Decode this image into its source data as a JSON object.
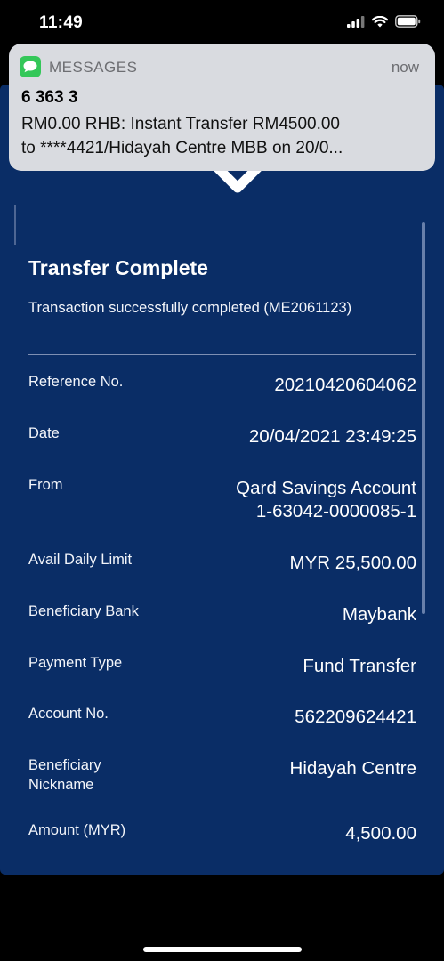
{
  "status": {
    "time": "11:49"
  },
  "notification": {
    "app": "MESSAGES",
    "time": "now",
    "sender": "6 363 3",
    "line1": "RM0.00 RHB: Instant Transfer RM4500.00",
    "line2": "to ****4421/Hidayah Centre MBB on 20/0..."
  },
  "receipt": {
    "title": "Transfer Complete",
    "subtitle": "Transaction successfully completed (ME2061123)",
    "rows": [
      {
        "label": "Reference No.",
        "value": "20210420604062"
      },
      {
        "label": "Date",
        "value": "20/04/2021 23:49:25"
      },
      {
        "label": "From",
        "value": "Qard Savings Account",
        "value2": "1-63042-0000085-1"
      },
      {
        "label": "Avail Daily Limit",
        "value": "MYR 25,500.00"
      },
      {
        "label": "Beneficiary Bank",
        "value": "Maybank"
      },
      {
        "label": "Payment Type",
        "value": "Fund Transfer"
      },
      {
        "label": "Account No.",
        "value": "562209624421"
      },
      {
        "label": "Beneficiary",
        "label2": "Nickname",
        "value": "Hidayah Centre"
      },
      {
        "label": "Amount (MYR)",
        "value": "4,500.00"
      }
    ]
  },
  "icons": {
    "success": "checkmark-icon",
    "app": "messages-icon",
    "signal": "cellular-signal-icon",
    "wifi": "wifi-icon",
    "battery": "battery-icon"
  },
  "colors": {
    "card_background": "#0a2d66",
    "success_green": "#33d96b",
    "notification_background": "#d9dbe0"
  }
}
